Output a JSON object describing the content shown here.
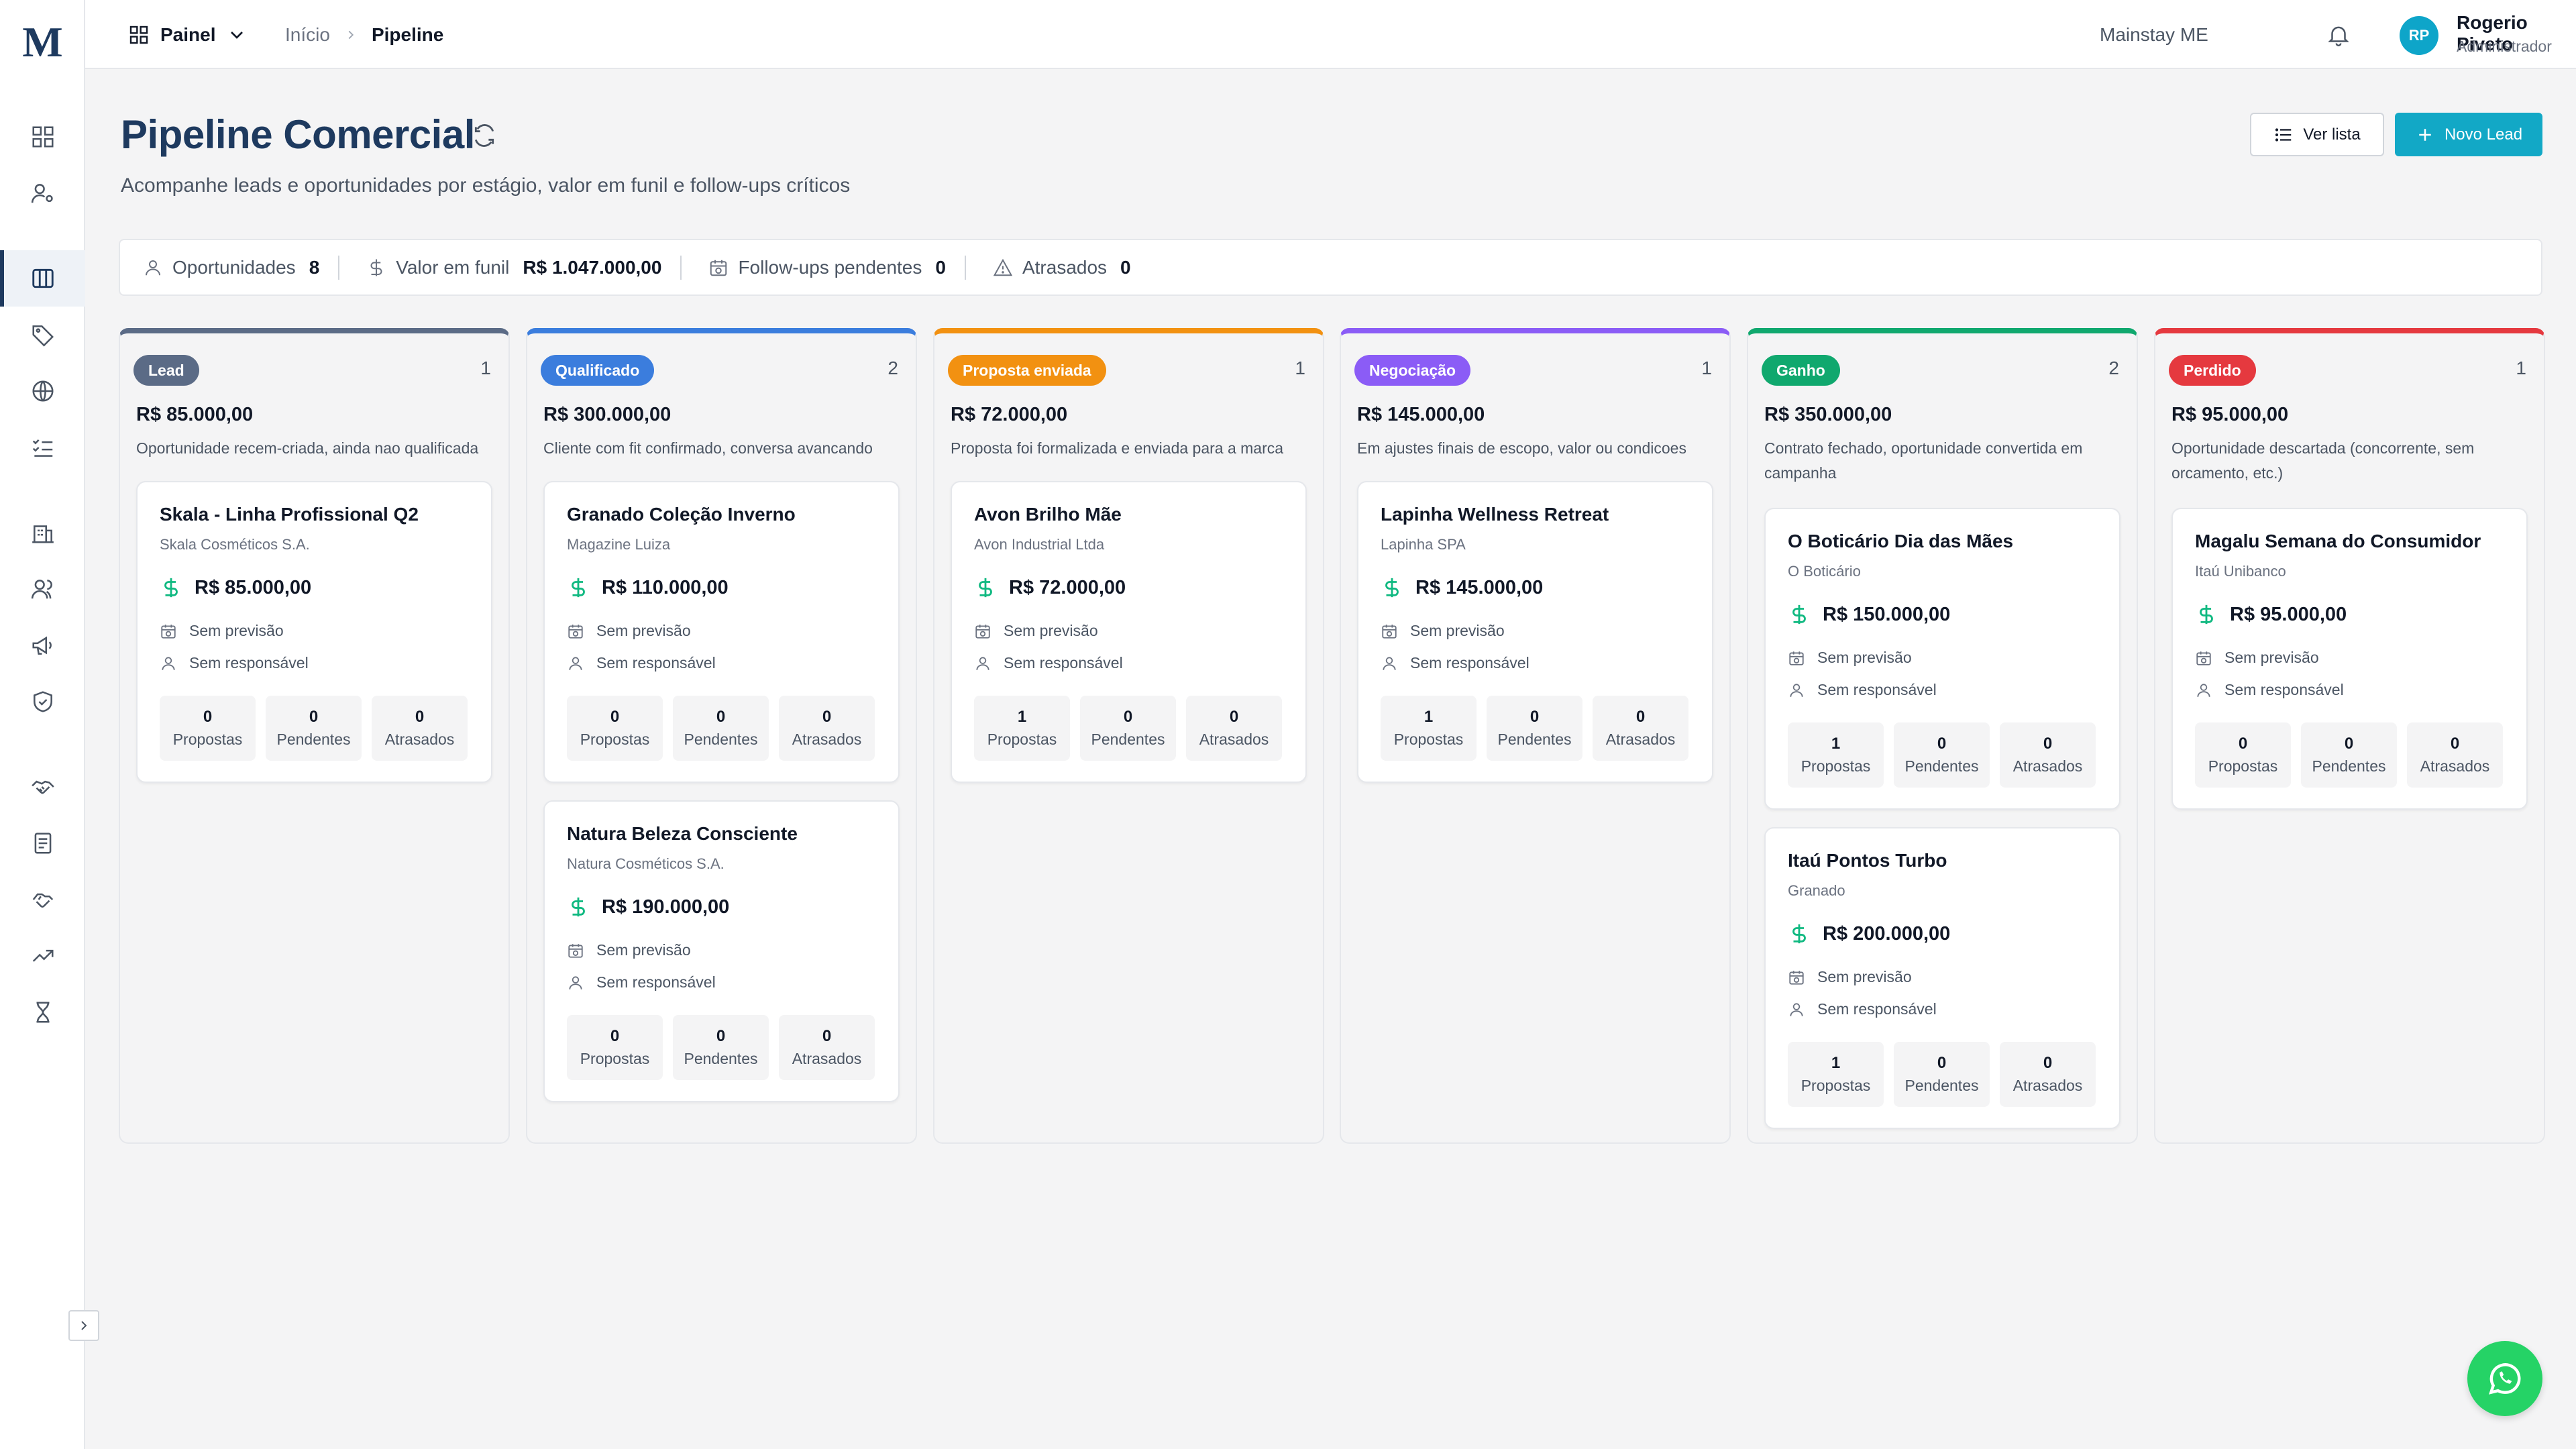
{
  "brand": {
    "logo": "M"
  },
  "sidebar": {
    "items": [
      {
        "icon": "dashboard-icon"
      },
      {
        "icon": "user-settings-icon"
      },
      {
        "icon": "pipeline-columns-icon",
        "active": true
      },
      {
        "icon": "tag-icon"
      },
      {
        "icon": "globe-icon"
      },
      {
        "icon": "checklist-icon"
      },
      {
        "icon": "building-icon"
      },
      {
        "icon": "users-icon"
      },
      {
        "icon": "megaphone-icon"
      },
      {
        "icon": "shield-check-icon"
      },
      {
        "icon": "handshake-icon"
      },
      {
        "icon": "document-icon"
      },
      {
        "icon": "handshake-alt-icon"
      },
      {
        "icon": "trending-up-icon"
      },
      {
        "icon": "hourglass-icon"
      }
    ]
  },
  "topbar": {
    "panel_label": "Painel",
    "breadcrumb": [
      "Início",
      "Pipeline"
    ],
    "company": "Mainstay ME",
    "user": {
      "initials": "RP",
      "name": "Rogerio Piveto",
      "role": "Administrador"
    }
  },
  "header": {
    "title": "Pipeline Comercial",
    "subtitle": "Acompanhe leads e oportunidades por estágio, valor em funil e follow-ups críticos",
    "view_list_label": "Ver lista",
    "new_lead_label": "Novo Lead"
  },
  "stats": {
    "opportunities": {
      "label": "Oportunidades",
      "value": "8"
    },
    "funnel_value": {
      "label": "Valor em funil",
      "value": "R$ 1.047.000,00"
    },
    "followups": {
      "label": "Follow-ups pendentes",
      "value": "0"
    },
    "overdue": {
      "label": "Atrasados",
      "value": "0"
    }
  },
  "labels": {
    "no_forecast": "Sem previsão",
    "no_owner": "Sem responsável",
    "proposals": "Propostas",
    "pending": "Pendentes",
    "overdue": "Atrasados"
  },
  "columns": [
    {
      "badge": "Lead",
      "color": "#5b6b86",
      "count": "1",
      "value": "R$ 85.000,00",
      "description": "Oportunidade recem-criada, ainda nao qualificada",
      "cards": [
        {
          "title": "Skala - Linha Profissional Q2",
          "company": "Skala Cosméticos S.A.",
          "value": "R$ 85.000,00",
          "proposals": "0",
          "pending": "0",
          "overdue": "0"
        }
      ]
    },
    {
      "badge": "Qualificado",
      "color": "#3b7ddd",
      "count": "2",
      "value": "R$ 300.000,00",
      "description": "Cliente com fit confirmado, conversa avancando",
      "cards": [
        {
          "title": "Granado Coleção Inverno",
          "company": "Magazine Luiza",
          "value": "R$ 110.000,00",
          "proposals": "0",
          "pending": "0",
          "overdue": "0"
        },
        {
          "title": "Natura Beleza Consciente",
          "company": "Natura Cosméticos S.A.",
          "value": "R$ 190.000,00",
          "proposals": "0",
          "pending": "0",
          "overdue": "0"
        }
      ]
    },
    {
      "badge": "Proposta enviada",
      "color": "#f29111",
      "count": "1",
      "value": "R$ 72.000,00",
      "description": "Proposta foi formalizada e enviada para a marca",
      "cards": [
        {
          "title": "Avon Brilho Mãe",
          "company": "Avon Industrial Ltda",
          "value": "R$ 72.000,00",
          "proposals": "1",
          "pending": "0",
          "overdue": "0"
        }
      ]
    },
    {
      "badge": "Negociação",
      "color": "#8b5cf6",
      "count": "1",
      "value": "R$ 145.000,00",
      "description": "Em ajustes finais de escopo, valor ou condicoes",
      "cards": [
        {
          "title": "Lapinha Wellness Retreat",
          "company": "Lapinha SPA",
          "value": "R$ 145.000,00",
          "proposals": "1",
          "pending": "0",
          "overdue": "0"
        }
      ]
    },
    {
      "badge": "Ganho",
      "color": "#10a86e",
      "count": "2",
      "value": "R$ 350.000,00",
      "description": "Contrato fechado, oportunidade convertida em campanha",
      "cards": [
        {
          "title": "O Boticário Dia das Mães",
          "company": "O Boticário",
          "value": "R$ 150.000,00",
          "proposals": "1",
          "pending": "0",
          "overdue": "0"
        },
        {
          "title": "Itaú Pontos Turbo",
          "company": "Granado",
          "value": "R$ 200.000,00",
          "proposals": "1",
          "pending": "0",
          "overdue": "0"
        }
      ]
    },
    {
      "badge": "Perdido",
      "color": "#e5393f",
      "count": "1",
      "value": "R$ 95.000,00",
      "description": "Oportunidade descartada (concorrente, sem orcamento, etc.)",
      "cards": [
        {
          "title": "Magalu Semana do Consumidor",
          "company": "Itaú Unibanco",
          "value": "R$ 95.000,00",
          "proposals": "0",
          "pending": "0",
          "overdue": "0"
        }
      ]
    }
  ],
  "colors": {
    "brand_navy": "#1e3a5f",
    "accent_cyan": "#12a8c6",
    "money_green": "#10b981",
    "whatsapp_green": "#25d366"
  }
}
